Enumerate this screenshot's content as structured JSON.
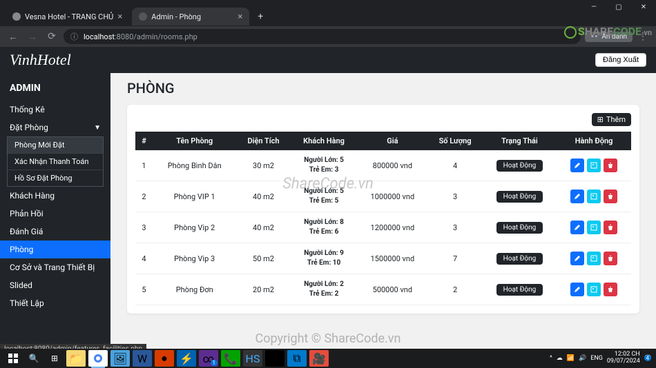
{
  "browser": {
    "tab1": "Vesna Hotel - TRANG CHỦ",
    "tab2": "Admin - Phòng",
    "url_prefix": "localhost",
    "url_rest": ":8080/admin/rooms.php",
    "incognito": "Ẩn danh",
    "hover_url": "localhost:8080/admin/features_facilities.php"
  },
  "app": {
    "logo": "VinhHotel",
    "logout": "Đăng Xuất"
  },
  "sidebar": {
    "title": "ADMIN",
    "items": [
      "Thống Kê",
      "Đặt Phòng",
      "Khách Hàng",
      "Phản Hồi",
      "Đánh Giá",
      "Phòng",
      "Cơ Sở và Trang Thiết Bị",
      "Slided",
      "Thiết Lập"
    ],
    "sub": [
      "Phòng Mới Đặt",
      "Xác Nhận Thanh Toán",
      "Hồ Sơ Đặt Phòng"
    ]
  },
  "page": {
    "heading": "PHÒNG",
    "add_btn": "Thêm"
  },
  "table": {
    "headers": [
      "#",
      "Tên Phòng",
      "Diện Tích",
      "Khách Hàng",
      "Giá",
      "Số Lượng",
      "Trạng Thái",
      "Hành Động"
    ],
    "guest_adult_label": "Người Lớn:",
    "guest_child_label": "Trẻ Em:",
    "status_active": "Hoạt Động",
    "rows": [
      {
        "idx": "1",
        "name": "Phòng Bình Dân",
        "area": "30 m2",
        "adults": "5",
        "children": "3",
        "price": "800000 vnd",
        "qty": "4"
      },
      {
        "idx": "2",
        "name": "Phòng VIP 1",
        "area": "40 m2",
        "adults": "5",
        "children": "5",
        "price": "1000000 vnd",
        "qty": "3"
      },
      {
        "idx": "3",
        "name": "Phòng Vip 2",
        "area": "40 m2",
        "adults": "8",
        "children": "6",
        "price": "1200000 vnd",
        "qty": "3"
      },
      {
        "idx": "4",
        "name": "Phòng Vip 3",
        "area": "50 m2",
        "adults": "9",
        "children": "10",
        "price": "1500000 vnd",
        "qty": "7"
      },
      {
        "idx": "5",
        "name": "Phòng Đơn",
        "area": "20 m2",
        "adults": "2",
        "children": "2",
        "price": "500000 vnd",
        "qty": "2"
      }
    ]
  },
  "taskbar": {
    "time": "12:02 CH",
    "date": "09/07/2024",
    "lang": "ENG",
    "notif_count": "4"
  },
  "watermark": {
    "brand_s": "S",
    "brand_hare": "HARE",
    "brand_code": "CODE",
    "brand_tld": ".vn",
    "center": "ShareCode.vn",
    "bottom": "Copyright © ShareCode.vn"
  }
}
